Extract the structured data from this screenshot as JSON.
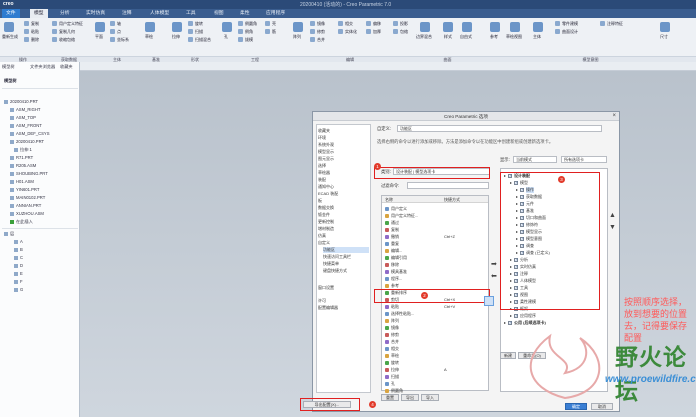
{
  "app": {
    "brand": "creo",
    "title": "20200410 (活动的) - Creo Parametric 7.0"
  },
  "tabs": [
    "文件",
    "模型",
    "分析",
    "实时仿真",
    "注释",
    "人体模型",
    "工具",
    "视图",
    "柔性",
    "应用程序"
  ],
  "ribbon": {
    "items": [
      "重新生成",
      "复制",
      "粘贴",
      "删除",
      "用户定义特征",
      "复制几何",
      "收缩包络",
      "轴",
      "点",
      "坐标系",
      "平面",
      "草绘",
      "拉伸",
      "旋转",
      "扫描",
      "扫描混合",
      "孔",
      "倒圆角",
      "倒角",
      "拔模",
      "壳",
      "筋",
      "阵列",
      "镜像",
      "修剪",
      "合并",
      "相交",
      "实体化",
      "偏移",
      "加厚",
      "投影",
      "包络",
      "边界混合",
      "样式",
      "自由式",
      "参考",
      "草绘视图",
      "主体",
      "零件建模",
      "曲面设计",
      "注释特征",
      "尺寸"
    ],
    "groups": [
      "操作",
      "获取数据",
      "主体",
      "基准",
      "形状",
      "工程",
      "编辑",
      "曲面",
      "模型意图"
    ]
  },
  "model_tree": {
    "tabs": [
      "模型树",
      "文件夹浏览器",
      "收藏夹"
    ],
    "header": "模型树",
    "items": [
      "20200410.PRT",
      "ASM_RIGHT",
      "ASM_TOP",
      "ASM_FRONT",
      "ASM_DEF_CSYS",
      "20200410.PRT",
      "拉伸 1",
      "R71.PRT",
      "R205.ASM",
      "SHOUBING.PRT",
      "H01.ASM",
      "YIN601.PRT",
      "MAIN0102.PRT",
      "ANNIAN.PRT",
      "XUZHOU.ASM",
      "在此插入"
    ],
    "layers_header": "层",
    "layers": [
      "A",
      "B",
      "C",
      "D",
      "E",
      "F",
      "G"
    ]
  },
  "dialog": {
    "title": "Creo Parametric 选项",
    "categories": [
      "收藏夹",
      "环境",
      "系统外观",
      "模型显示",
      "图元显示",
      "选择",
      "草绘器",
      "装配",
      "通知中心",
      "ECAD 装配",
      "板",
      "数据交换",
      "钣金件",
      "更新控制",
      "增材制造",
      "仿真",
      "自定义",
      "功能区",
      "快速访问工具栏",
      "快捷菜单",
      "键盘快捷方式",
      "窗口设置",
      "许可",
      "配置编辑器"
    ],
    "customize_label": "自定义:",
    "customize_value": "功能区",
    "description": "选择右侧的命令以进行添加或移除。方法是添加命令以在功能区中创建新组或创建新选项卡。",
    "category_label": "类别:",
    "category_value": "设计装配 | 模型选项卡",
    "filter_label": "过滤命令:",
    "source_headers": [
      "名称",
      "快捷方式"
    ],
    "source_commands": [
      {
        "name": "用户定义",
        "key": ""
      },
      {
        "name": "用户定义特征...",
        "key": ""
      },
      {
        "name": "通过",
        "key": ""
      },
      {
        "name": "复制",
        "key": ""
      },
      {
        "name": "撤销",
        "key": "Ctrl+Z"
      },
      {
        "name": "重复",
        "key": ""
      },
      {
        "name": "编辑...",
        "key": ""
      },
      {
        "name": "编辑引用",
        "key": ""
      },
      {
        "name": "移除",
        "key": ""
      },
      {
        "name": "模具基准",
        "key": ""
      },
      {
        "name": "程序...",
        "key": ""
      },
      {
        "name": "参考",
        "key": ""
      },
      {
        "name": "重新排序",
        "key": ""
      },
      {
        "name": "剪切",
        "key": "Ctrl+X"
      },
      {
        "name": "粘贴",
        "key": "Ctrl+V"
      },
      {
        "name": "选择性粘贴...",
        "key": ""
      },
      {
        "name": "阵列",
        "key": ""
      },
      {
        "name": "镜像",
        "key": ""
      },
      {
        "name": "修剪",
        "key": ""
      },
      {
        "name": "合并",
        "key": ""
      },
      {
        "name": "相交",
        "key": ""
      },
      {
        "name": "草绘",
        "key": ""
      },
      {
        "name": "旋转",
        "key": ""
      },
      {
        "name": "拉伸",
        "key": "A"
      },
      {
        "name": "扫描",
        "key": ""
      },
      {
        "name": "孔",
        "key": ""
      },
      {
        "name": "倒圆角",
        "key": ""
      }
    ],
    "display_label": "显示:",
    "display_value": "当前模式",
    "display_value2": "所有选项卡",
    "target_tree": [
      {
        "label": "设计装配",
        "depth": 0
      },
      {
        "label": "模型",
        "depth": 1
      },
      {
        "label": "操作",
        "depth": 2,
        "highlight": true
      },
      {
        "label": "获取数据",
        "depth": 2
      },
      {
        "label": "元件",
        "depth": 2
      },
      {
        "label": "基准",
        "depth": 2
      },
      {
        "label": "切口和曲面",
        "depth": 2
      },
      {
        "label": "修饰符",
        "depth": 2
      },
      {
        "label": "模型显示",
        "depth": 2
      },
      {
        "label": "模型意图",
        "depth": 2
      },
      {
        "label": "调查",
        "depth": 2
      },
      {
        "label": "调查 (已定义)",
        "depth": 2
      },
      {
        "label": "分析",
        "depth": 1
      },
      {
        "label": "实时仿真",
        "depth": 1
      },
      {
        "label": "注释",
        "depth": 1
      },
      {
        "label": "人体模型",
        "depth": 1
      },
      {
        "label": "工具",
        "depth": 1
      },
      {
        "label": "视图",
        "depth": 1
      },
      {
        "label": "柔性建模",
        "depth": 1
      },
      {
        "label": "框架",
        "depth": 1
      },
      {
        "label": "应用程序",
        "depth": 1
      },
      {
        "label": "公用 (后续选项卡)",
        "depth": 0
      }
    ],
    "bottom_left": [
      "重置",
      "导出",
      "导入"
    ],
    "bottom_right": [
      "新建",
      "重命名(O)"
    ],
    "export_button": "导出配置(X)...",
    "ok": "确定",
    "cancel": "取消",
    "drag_item": "重新生成"
  },
  "annotations": {
    "b1": "1",
    "b2": "2",
    "b3": "3",
    "b4": "4",
    "note": "按照顺序选择，放到想要的位置去，记得要保存配置"
  },
  "watermark": {
    "title": "野火论坛",
    "url": "www.proewildfire.cn"
  }
}
